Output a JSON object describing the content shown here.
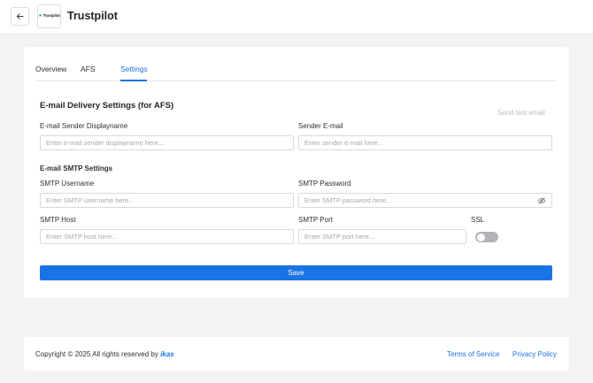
{
  "header": {
    "title": "Trustpilot",
    "logo_text": "Trustpilot"
  },
  "tabs": [
    {
      "label": "Overview",
      "active": false
    },
    {
      "label": "AFS",
      "active": false
    },
    {
      "label": "Settings",
      "active": true
    }
  ],
  "form": {
    "section_title": "E-mail Delivery Settings (for AFS)",
    "send_test_label": "Send test email",
    "sender_name": {
      "label": "E-mail Sender Displayname",
      "value": "",
      "placeholder": "Enter e-mail sender displayname here..."
    },
    "sender_email": {
      "label": "Sender E-mail",
      "value": "",
      "placeholder": "Enter sender e-mail here..."
    },
    "smtp_section_title": "E-mail SMTP Settings",
    "smtp_username": {
      "label": "SMTP Username",
      "value": "",
      "placeholder": "Enter SMTP username here..."
    },
    "smtp_password": {
      "label": "SMTP Password",
      "value": "",
      "placeholder": "Enter SMTP password here..."
    },
    "smtp_host": {
      "label": "SMTP Host",
      "value": "",
      "placeholder": "Enter SMTP host here..."
    },
    "smtp_port": {
      "label": "SMTP Port",
      "value": "",
      "placeholder": "Enter SMTP port here..."
    },
    "ssl": {
      "label": "SSL",
      "enabled": false
    },
    "save_label": "Save"
  },
  "footer": {
    "copyright_prefix": "Copyright © 2025 All rights reserved by ",
    "brand": "ikas",
    "terms_label": "Terms of Service",
    "privacy_label": "Privacy Policy"
  },
  "colors": {
    "accent": "#1b74e4",
    "trustpilot_green": "#00b67a",
    "toggle_off": "#b0b3b8",
    "page_bg": "#f3f3f4"
  },
  "icons": {
    "back": "arrow-left-icon",
    "password_visibility": "eye-slash-icon",
    "logo_star": "star-icon"
  }
}
